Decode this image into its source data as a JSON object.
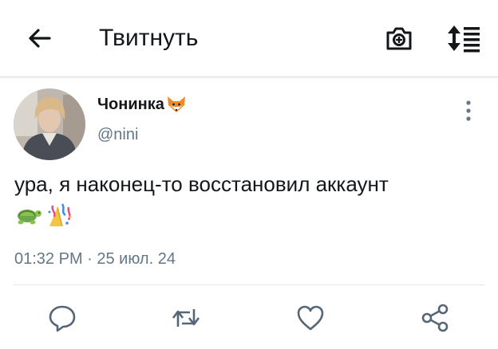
{
  "header": {
    "title": "Твитнуть",
    "icons": [
      "back-arrow-icon",
      "camera-icon",
      "sort-icon"
    ]
  },
  "tweet": {
    "author": {
      "display_name": "Чонинка",
      "name_emoji": "fox-face-icon",
      "handle": "@nini"
    },
    "text": "ура, я наконец-то восстановил аккаунт",
    "emojis": [
      "turtle-icon",
      "confetti-icon"
    ],
    "timestamp": "01:32 PM · 25 июл. 24"
  },
  "actions": [
    "reply-icon",
    "retweet-icon",
    "like-icon",
    "share-icon"
  ],
  "colors": {
    "text": "#14171a",
    "secondary": "#657786",
    "divider": "#e1e8ed",
    "action_icon": "#556677"
  }
}
